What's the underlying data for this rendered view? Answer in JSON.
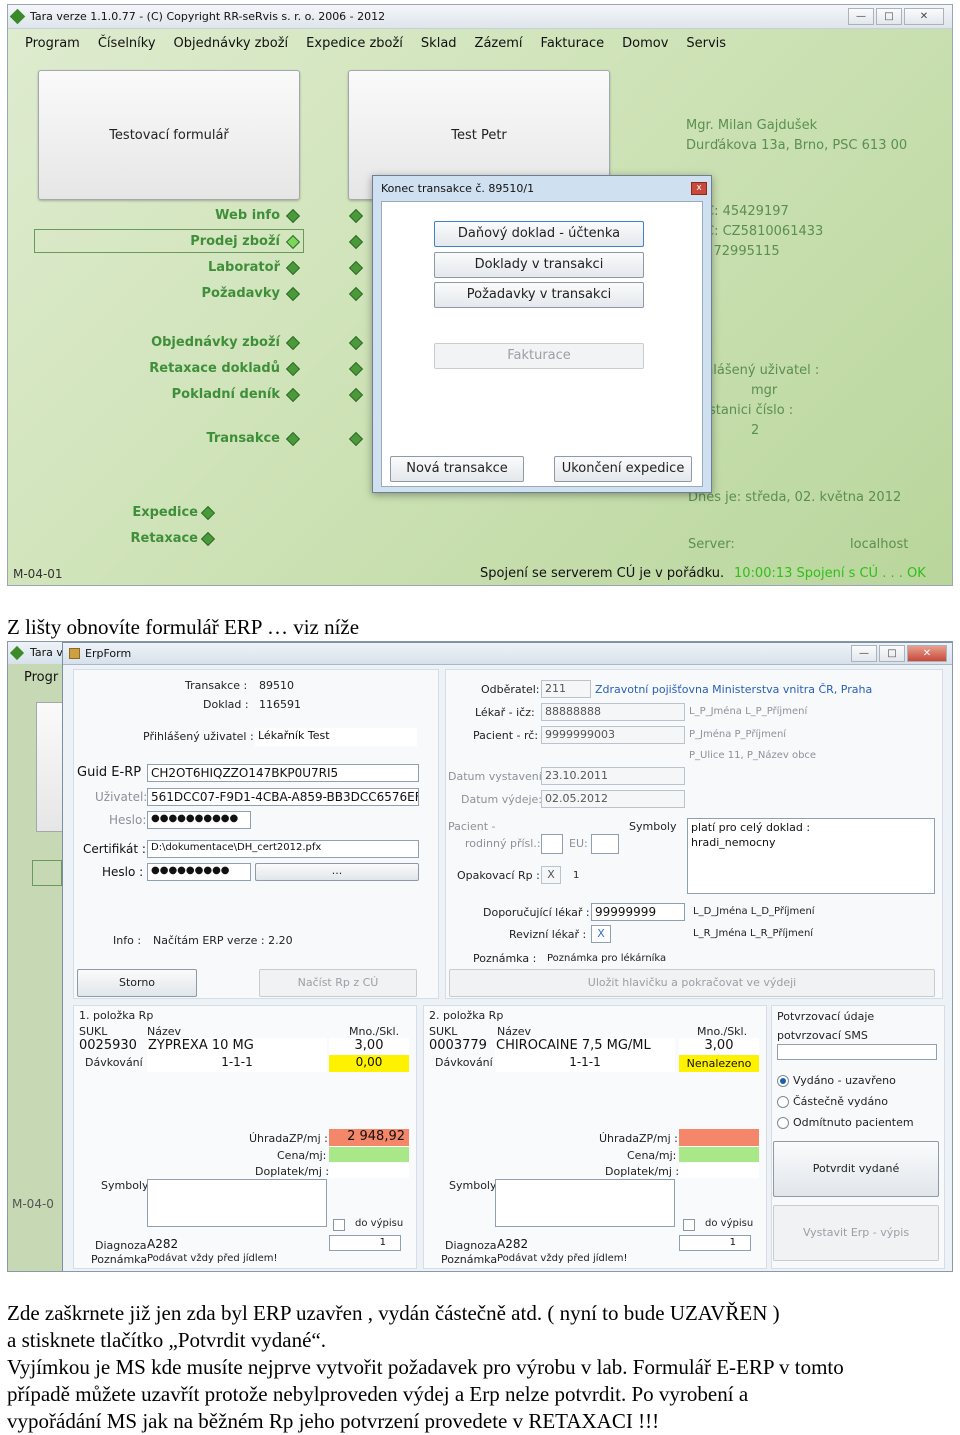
{
  "screen1": {
    "title": "Tara verze 1.1.0.77  -  (C) Copyright RR-seRvis s. r. o. 2006 - 2012",
    "window_controls": [
      "—",
      "□",
      "✕"
    ],
    "menu": [
      "Program",
      "Číselníky",
      "Objednávky zboží",
      "Expedice zboží",
      "Sklad",
      "Zázemí",
      "Fakturace",
      "Domov",
      "Servis"
    ],
    "big_buttons": [
      "Testovací formulář",
      "Test Petr"
    ],
    "nav": [
      "Web info",
      "Prodej zboží",
      "Laboratoř",
      "Požadavky",
      "Objednávky zboží",
      "Retaxace dokladů",
      "Pokladní deník",
      "Transakce"
    ],
    "nav2": [
      "Expedice",
      "Retaxace"
    ],
    "company": {
      "name": "Mgr. Milan Gajdušek",
      "address": "Durďákova 13a, Brno, PSC 613 00",
      "ic": "Č: 45429197",
      "dic": "Č: CZ5810061433",
      "code": ": 72995115"
    },
    "user": {
      "label": "hlášený uživatel :",
      "name": "mgr",
      "station_label": "stanici číslo :",
      "station": "2"
    },
    "today": "Dnes je:  středa, 02. května 2012",
    "server_label": "Server:",
    "server": "localhost",
    "status_left": "M-04-01",
    "status_msg": "Spojení se serverem CÚ je v pořádku.",
    "status_time": "10:00:13 Spojení s CÚ . . . OK",
    "dialog": {
      "title": "Konec transakce č. 89510/1",
      "close": "x",
      "buttons": [
        "Daňový doklad - účtenka",
        "Doklady v transakci",
        "Požadavky v transakci"
      ],
      "disabled": "Fakturace",
      "new": "Nová transakce",
      "end": "Ukončení expedice"
    }
  },
  "caption1": "Z lišty obnovíte formulář ERP … viz níže",
  "screen2": {
    "bg_title": "Tara v",
    "bg_menu": "Progr",
    "bg_status": "M-04-0",
    "title": "ErpForm",
    "transakce_label": "Transakce :",
    "transakce": "89510",
    "doklad_label": "Doklad :",
    "doklad": "116591",
    "prihlaseny_label": "Přihlášený uživatel :",
    "prihlaseny": "Lékařník Test",
    "guid_label": "Guid E-RP",
    "guid": "CH2OT6HIQZZO147BKP0U7RI5",
    "uzivatel_label": "Uživatel:",
    "uzivatel": "561DCC07-F9D1-4CBA-A859-BB3DCC6576EF",
    "heslo_label": "Heslo:",
    "heslo": "●●●●●●●●●●",
    "cert_label": "Certifikát :",
    "cert": "D:\\dokumentace\\DH_cert2012.pfx",
    "heslo2_label": "Heslo :",
    "heslo2": "●●●●●●●●●",
    "browse": "...",
    "info_label": "Info :",
    "info": "Načítám ERP verze : 2.20",
    "storno": "Storno",
    "nacist": "Načíst Rp z CÚ",
    "odberatel_label": "Odběratel:",
    "odberatel": "211",
    "odberatel_name": "Zdravotní pojišťovna Ministerstva vnitra ČR, Praha",
    "lekar_label": "Lékař - ičz:",
    "lekar": "88888888",
    "lekar_name": "L_P_Jména L_P_Příjmení",
    "pacient_label": "Pacient - rč:",
    "pacient": "9999999003",
    "pacient_name": "P_Jména P_Příjmení",
    "pacient_addr": "P_Ulice 11, P_Název obce",
    "datum_vyst_label": "Datum vystavení:",
    "datum_vyst": "23.10.2011",
    "datum_vyd_label": "Datum výdeje:",
    "datum_vyd": "02.05.2012",
    "pacient_rod_label": "Pacient -",
    "rodinny_label": "rodinný přísl.:",
    "eu_label": "EU:",
    "symboly_label": "Symboly",
    "symboly_text": "platí pro celý doklad :\nhradi_nemocny",
    "opak_label": "Opakovací Rp :",
    "opak_check": "X",
    "opak_val": "1",
    "doporucujici_label": "Doporučující lékař :",
    "doporucujici": "99999999",
    "dop_name": "L_D_Jména L_D_Příjmení",
    "revizni_label": "Revizní lékař :",
    "revizni": "X",
    "rev_name": "L_R_Jména L_R_Příjmení",
    "poznamka_label": "Poznámka :",
    "poznamka": "Poznámka pro lékárníka",
    "ulozit": "Uložit hlavičku a pokračovat ve výdeji",
    "items": [
      {
        "head": "1. položka  Rp",
        "sukl": "0025930",
        "nazev": "ZYPREXA 10 MG",
        "mno": "3,00",
        "mno2": "0,00",
        "davkovani": "1-1-1",
        "uhrada": "2 948,92",
        "diagnoza": "A282",
        "poznamka": "Podávat vždy před jídlem!",
        "spin": "1"
      },
      {
        "head": "2. položka  Rp",
        "sukl": "0003779",
        "nazev": "CHIROCAINE 7,5 MG/ML",
        "mno": "3,00",
        "mno2": "Nenalezeno",
        "davkovani": "1-1-1",
        "uhrada": "",
        "diagnoza": "A282",
        "poznamka": "Podávat vždy před jídlem!",
        "spin": "1"
      }
    ],
    "item_labels": {
      "sukl": "SUKL",
      "nazev": "Název",
      "mno": "Mno./Skl.",
      "davkovani": "Dávkování",
      "uhrada": "ÚhradaZP/mj :",
      "cena": "Cena/mj:",
      "doplatek": "Doplatek/mj :",
      "symboly": "Symboly",
      "do_vypisu": "do výpisu",
      "diagnoza": "Diagnoza",
      "poznamka": "Poznámka"
    },
    "potvrz_label": "Potvrzovací údaje",
    "potvrz_sms": "potvrzovací  SMS",
    "radios": [
      "Vydáno - uzavřeno",
      "Částečně vydáno",
      "Odmítnuto pacientem"
    ],
    "potvrdit": "Potvrdit vydané",
    "vystavit": "Vystavit Erp - výpis"
  },
  "paragraph": [
    "Zde zaškrnete již jen  zda byl ERP uzavřen , vydán částečně  atd. ( nyní to bude UZAVŘEN )",
    "a stisknete tlačítko „Potvrdit vydané“.",
    "Vyjímkou je MS kde musíte nejprve vytvořit požadavek pro výrobu v lab. Formulář  E-ERP v tomto",
    "případě můžete uzavřít protože nebylproveden výdej a Erp  nelze potvrdit.  Po vyrobení a",
    "vypořádání MS jak na běžném Rp jeho potvrzení provedete v RETAXACI !!!"
  ]
}
